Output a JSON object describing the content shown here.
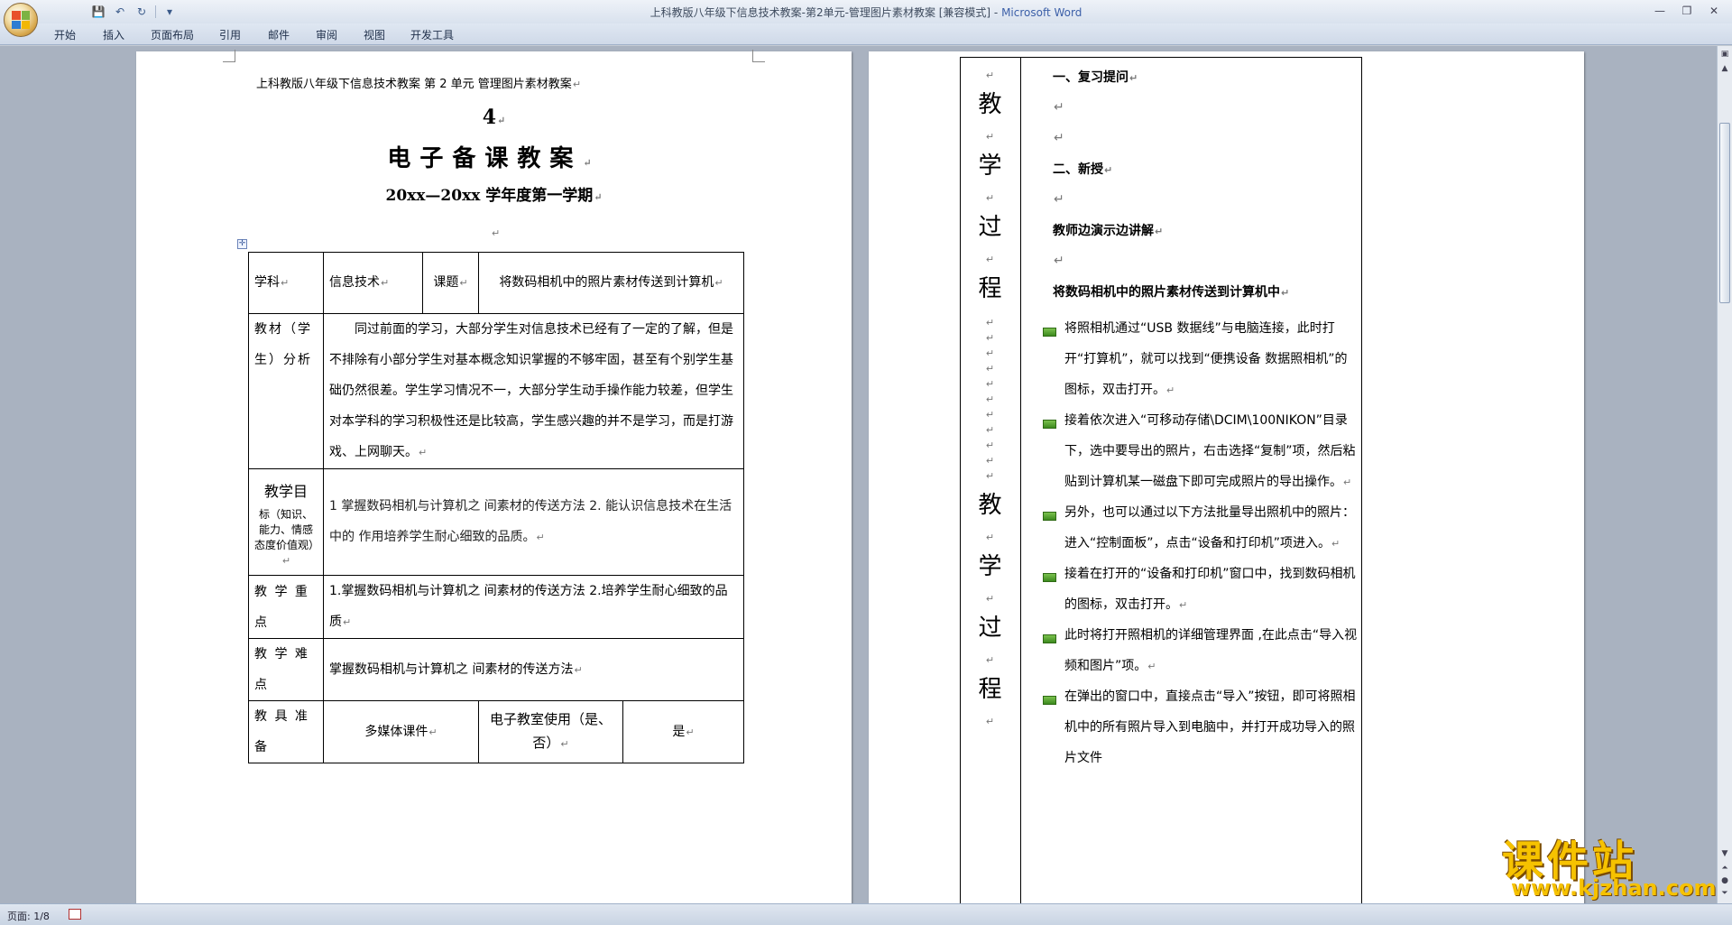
{
  "window": {
    "title": "上科教版八年级下信息技术教案-第2单元-管理图片素材教案 [兼容模式] - ",
    "app": "Microsoft Word"
  },
  "tabs": [
    "开始",
    "插入",
    "页面布局",
    "引用",
    "邮件",
    "审阅",
    "视图",
    "开发工具"
  ],
  "status": {
    "page": "页面: 1/8"
  },
  "page1": {
    "header": "上科教版八年级下信息技术教案 第 2 单元 管理图片素材教案",
    "num": "4",
    "title": "电子备课教案",
    "term": "20xx—20xx 学年度第一学期",
    "table": {
      "r1": {
        "subject_lbl": "学科",
        "subject": "信息技术",
        "topic_lbl": "课题",
        "topic": "将数码相机中的照片素材传送到计算机"
      },
      "r2": {
        "lbl": "教材（学生）分析",
        "text": "同过前面的学习，大部分学生对信息技术已经有了一定的了解，但是不排除有小部分学生对基本概念知识掌握的不够牢固，甚至有个别学生基础仍然很差。学生学习情况不一，大部分学生动手操作能力较差，但学生对本学科的学习积极性还是比较高，学生感兴趣的并不是学习，而是打游戏、上网聊天。"
      },
      "r3": {
        "lbl1": "教学目",
        "lbl2": "标（知识、能力、情感态度价值观）",
        "text": "1 掌握数码相机与计算机之 间素材的传送方法 2. 能认识信息技术在生活 中的 作用培养学生耐心细致的品质。"
      },
      "r4": {
        "lbl": "教 学 重 点",
        "text": "1.掌握数码相机与计算机之 间素材的传送方法 2.培养学生耐心细致的品质"
      },
      "r5": {
        "lbl": "教 学 难 点",
        "text": "掌握数码相机与计算机之 间素材的传送方法"
      },
      "r6": {
        "lbl": "教 具 准 备",
        "tool": "多媒体课件",
        "room_lbl": "电子教室使用（是、否）",
        "room": "是"
      }
    }
  },
  "page2": {
    "vlabel": [
      "教",
      "学",
      "过",
      "程",
      "教",
      "学",
      "过",
      "程"
    ],
    "lines": {
      "review": "一、复习提问",
      "new": "二、新授",
      "teacher": "教师边演示边讲解",
      "topic": "将数码相机中的照片素材传送到计算机中"
    },
    "bullets": [
      "将照相机通过“USB 数据线”与电脑连接，此时打开“打算机”，就可以找到“便携设备 数据照相机”的图标，双击打开。",
      "接着依次进入“可移动存储\\DCIM\\100NIKON”目录下，选中要导出的照片，右击选择“复制”项，然后粘贴到计算机某一磁盘下即可完成照片的导出操作。",
      "另外，也可以通过以下方法批量导出照机中的照片：进入“控制面板”，点击“设备和打印机”项进入。",
      "接着在打开的“设备和打印机”窗口中，找到数码相机的图标，双击打开。",
      "此时将打开照相机的详细管理界面 ,在此点击“导入视频和图片”项。",
      "在弹出的窗口中，直接点击“导入”按钮，即可将照相机中的所有照片导入到电脑中，并打开成功导入的照片文件"
    ]
  },
  "watermark": {
    "text": "课件站",
    "url": "www.kjzhan.com"
  },
  "colors": {
    "accent": "#f6c200",
    "bullet": "#5aa532",
    "ribbon": "#dfe7f2"
  }
}
